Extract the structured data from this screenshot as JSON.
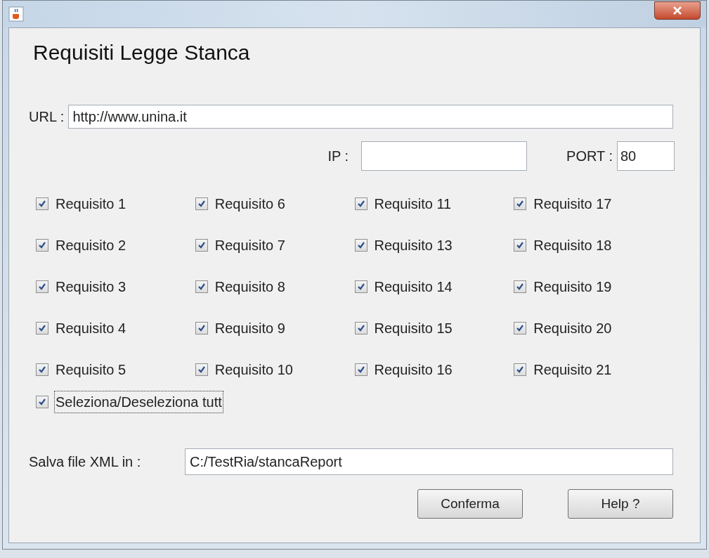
{
  "heading": "Requisiti Legge Stanca",
  "url": {
    "label": "URL :",
    "value": "http://www.unina.it"
  },
  "ip": {
    "label": "IP :"
  },
  "port": {
    "label": "PORT :",
    "value": "80"
  },
  "columns": [
    [
      {
        "label": "Requisito 1",
        "checked": true
      },
      {
        "label": "Requisito 2",
        "checked": true
      },
      {
        "label": "Requisito 3",
        "checked": true
      },
      {
        "label": "Requisito 4",
        "checked": true
      },
      {
        "label": "Requisito 5",
        "checked": true
      }
    ],
    [
      {
        "label": "Requisito 6",
        "checked": true
      },
      {
        "label": "Requisito 7",
        "checked": true
      },
      {
        "label": "Requisito 8",
        "checked": true
      },
      {
        "label": "Requisito 9",
        "checked": true
      },
      {
        "label": "Requisito 10",
        "checked": true
      }
    ],
    [
      {
        "label": "Requisito 11",
        "checked": true
      },
      {
        "label": "Requisito 13",
        "checked": true
      },
      {
        "label": "Requisito 14",
        "checked": true
      },
      {
        "label": "Requisito 15",
        "checked": true
      },
      {
        "label": "Requisito 16",
        "checked": true
      }
    ],
    [
      {
        "label": "Requisito 17",
        "checked": true
      },
      {
        "label": "Requisito 18",
        "checked": true
      },
      {
        "label": "Requisito 19",
        "checked": true
      },
      {
        "label": "Requisito 20",
        "checked": true
      },
      {
        "label": "Requisito 21",
        "checked": true
      }
    ]
  ],
  "select_all": {
    "label": "Seleziona/Deseleziona tutt",
    "checked": true,
    "focused": true
  },
  "save": {
    "label": "Salva file XML in :",
    "value": "C:/TestRia/stancaReport"
  },
  "buttons": [
    "Conferma",
    "Help ?"
  ]
}
